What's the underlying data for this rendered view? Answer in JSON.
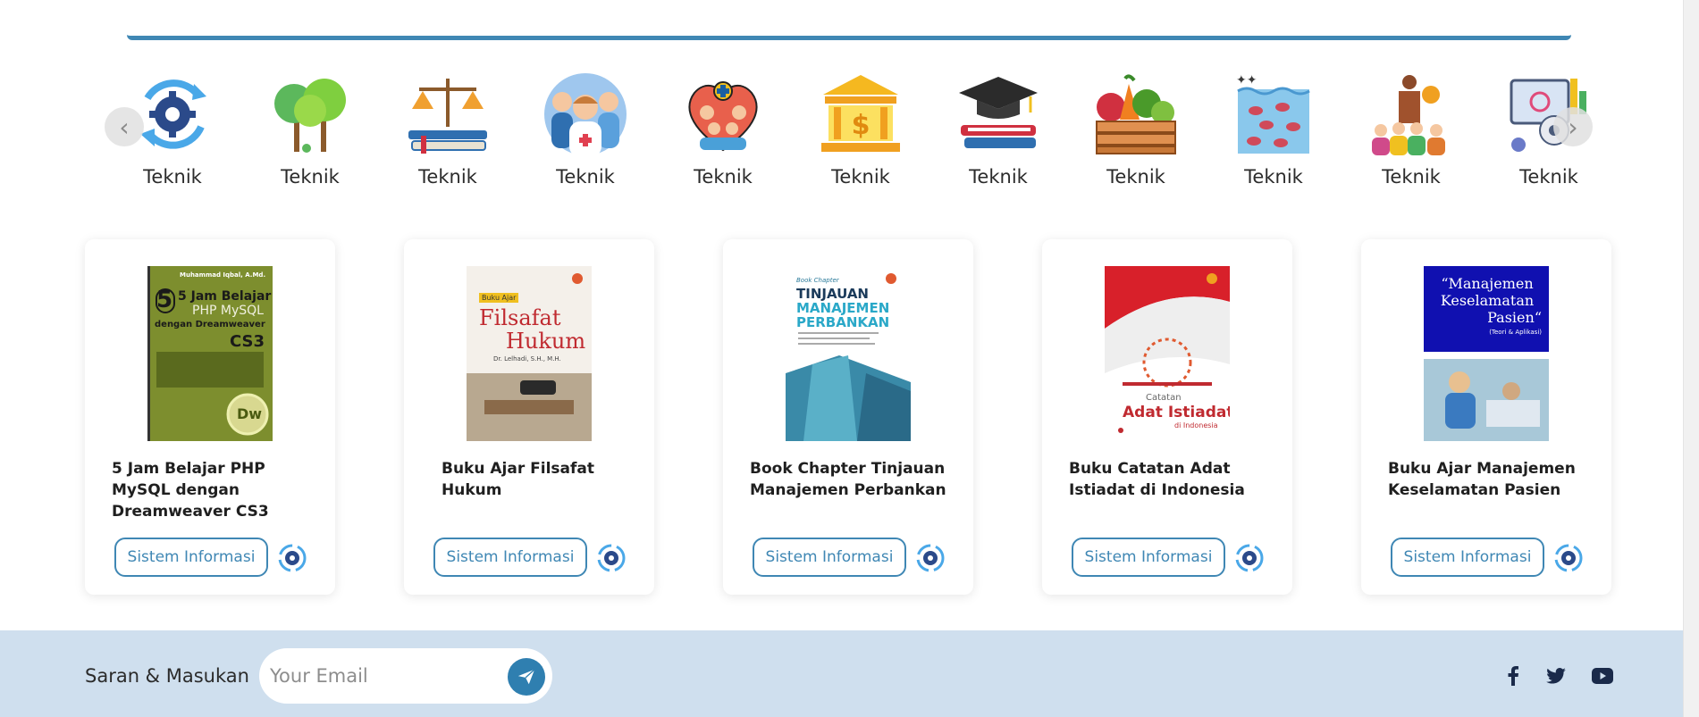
{
  "categories": [
    {
      "label": "Teknik",
      "icon": "engineering-gear-icon"
    },
    {
      "label": "Teknik",
      "icon": "trees-icon"
    },
    {
      "label": "Teknik",
      "icon": "law-scales-books-icon"
    },
    {
      "label": "Teknik",
      "icon": "medical-staff-icon"
    },
    {
      "label": "Teknik",
      "icon": "family-health-icon"
    },
    {
      "label": "Teknik",
      "icon": "bank-icon"
    },
    {
      "label": "Teknik",
      "icon": "graduation-books-icon"
    },
    {
      "label": "Teknik",
      "icon": "vegetable-crate-icon"
    },
    {
      "label": "Teknik",
      "icon": "fish-aquarium-icon"
    },
    {
      "label": "Teknik",
      "icon": "lecture-audience-icon"
    },
    {
      "label": "Teknik",
      "icon": "science-presentation-icon"
    }
  ],
  "carousel": {
    "prev_icon": "chevron-left-icon",
    "next_icon": "chevron-right-icon"
  },
  "books": [
    {
      "title": "5 Jam Belajar PHP MySQL dengan Dreamweaver CS3",
      "tag": "Sistem Informasi",
      "cover": {
        "author": "Muhammad Iqbal, A.Md.",
        "line1": "5 Jam Belajar",
        "line2": "PHP MySQL",
        "line3": "dengan Dreamweaver",
        "line4": "CS3",
        "badge": "Dw"
      }
    },
    {
      "title": "Buku Ajar Filsafat Hukum",
      "tag": "Sistem Informasi",
      "cover": {
        "kicker": "Buku Ajar",
        "line1": "Filsafat",
        "line2": "Hukum",
        "author": "Dr. Lelhadi, S.H., M.H."
      }
    },
    {
      "title": "Book Chapter Tinjauan Manajemen Perbankan",
      "tag": "Sistem Informasi",
      "cover": {
        "kicker": "Book Chapter",
        "line1": "TINJAUAN",
        "line2": "MANAJEMEN",
        "line3": "PERBANKAN"
      }
    },
    {
      "title": "Buku Catatan Adat Istiadat di Indonesia",
      "tag": "Sistem Informasi",
      "cover": {
        "line1": "Catatan",
        "line2": "Adat Istiadat",
        "line3": "di Indonesia"
      }
    },
    {
      "title": "Buku Ajar Manajemen Keselamatan Pasien",
      "tag": "Sistem Informasi",
      "cover": {
        "line1": "“Manajemen",
        "line2": "Keselamatan",
        "line3": "Pasien“",
        "line4": "(Teori & Aplikasi)"
      }
    }
  ],
  "footer": {
    "label": "Saran & Masukan",
    "email_placeholder": "Your Email",
    "send_icon": "send-plane-icon",
    "social": [
      {
        "icon": "facebook-icon"
      },
      {
        "icon": "twitter-icon"
      },
      {
        "icon": "youtube-icon"
      }
    ]
  },
  "colors": {
    "accent": "#3f87b4",
    "footer_bg": "#cfdfee",
    "text": "#2b2b2b"
  }
}
